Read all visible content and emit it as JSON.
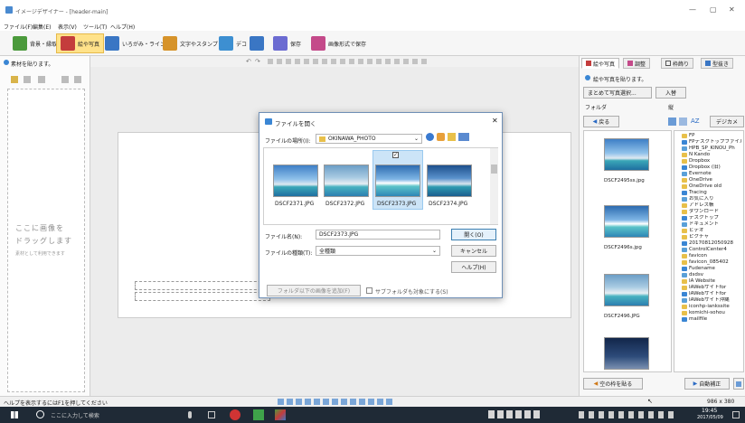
{
  "app": {
    "title": "イメージデザイナー - [header-main]",
    "window_controls": [
      "—",
      "▢",
      "✕"
    ]
  },
  "menu": [
    "ファイル(F)",
    "編集(E)",
    "表示(V)",
    "ツール(T)",
    "ヘルプ(H)"
  ],
  "ribbon": [
    {
      "label": "背景・縁取り",
      "color": "#4b9a3c"
    },
    {
      "label": "絵や写真",
      "color": "#c43c3c",
      "active": true
    },
    {
      "label": "いろがみ・ライン",
      "color": "#3a76c4"
    },
    {
      "label": "文字やスタンプ",
      "color": "#d6932a"
    },
    {
      "label": "デコ",
      "color": "#3d8fd1"
    },
    {
      "label": "",
      "color": "#3a76c4"
    },
    {
      "label": "保存",
      "color": "#6b6bd1"
    },
    {
      "label": "画像形式で保存",
      "color": "#c44a8a"
    }
  ],
  "left_panel": {
    "header": "素材を貼ります。",
    "drop_hint": [
      "ここに画像を",
      "ドラッグします"
    ],
    "drop_sub": "素材として利用できます"
  },
  "dialog": {
    "title": "ファイルを開く",
    "location_label": "ファイルの場所(I):",
    "location_value": "OKINAWA_PHOTO",
    "files": [
      "DSCF2371.JPG",
      "DSCF2372.JPG",
      "DSCF2373.JPG",
      "DSCF2374.JPG"
    ],
    "filename_label": "ファイル名(N):",
    "filename_value": "DSCF2373.JPG",
    "filetype_label": "ファイルの種類(T):",
    "filetype_value": "全種類",
    "open_button": "開く(O)",
    "cancel_button": "キャンセル",
    "help_button": "ヘルプ(H)",
    "add_condition_button": "フォルダ以下の画像を追加(F)",
    "subfolder_checkbox": "サブフォルダも対象にする(S)"
  },
  "right_panel": {
    "tabs": [
      "絵や写真",
      "調整",
      "枠飾り",
      "型抜き"
    ],
    "header": "絵や写真を貼ります。",
    "batch_button": "まとめて写真選択...",
    "import_button": "入替",
    "folder_label": "フォルダ",
    "back_button": "戻る",
    "sort_label": "AZ",
    "digital_label": "デジカメ",
    "thumbs": [
      "DSCF2495ss.jpg",
      "DSCF2496s.jpg",
      "DSCF2496.JPG"
    ],
    "folders": [
      "FP",
      "FPデスクトップファイル",
      "HPB_SP_KINOU_Ph",
      "N Kando",
      "Dropbox",
      "Dropbox (旧)",
      "Evernote",
      "OneDrive",
      "OneDrive old",
      "Tracing",
      "お気に入り",
      "アドレス帳",
      "ダウンロード",
      "デスクトップ",
      "ドキュメント",
      "ビデオ",
      "ピクチャ",
      "20170812050928",
      "ControlCenter4",
      "favicon",
      "favicon_085402",
      "Fudename",
      "dsdsv",
      "IA Website",
      "IAWebサイトfor",
      "IAWebサイトfor",
      "IAWebサイト沖縄",
      "iconhp-iankssite",
      "komichi-sohou",
      "mailfile"
    ],
    "empty_frame_button": "空の枠を貼る",
    "auto_button": "自動補正"
  },
  "status": {
    "help_text": "ヘルプを表示するにはF1を押してください",
    "size": "986 x 380"
  },
  "taskbar": {
    "search_placeholder": "ここに入力して検索",
    "time": "19:45",
    "date": "2017/05/09"
  }
}
